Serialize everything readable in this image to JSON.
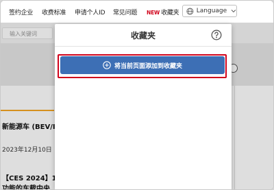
{
  "nav": {
    "items": [
      "签约企业",
      "收费标准",
      "申请个人ID",
      "常见问题"
    ],
    "new_badge": "NEW",
    "favorites_label": "收藏夹",
    "language_label": "Language"
  },
  "search": {
    "placeholder": "输入关键词"
  },
  "articles": [
    {
      "title": "新能源车 (BEV/I",
      "date": "2023年12月10日"
    },
    {
      "title_line1": "【CES 2024】1",
      "title_line2": "功能的车载中央"
    }
  ],
  "popup": {
    "title": "收藏夹",
    "add_button_label": "将当前页面添加到收藏夹"
  },
  "colors": {
    "button_blue": "#3d6fb5",
    "highlight_red": "#d0021b",
    "accent_orange": "#f5a623"
  }
}
